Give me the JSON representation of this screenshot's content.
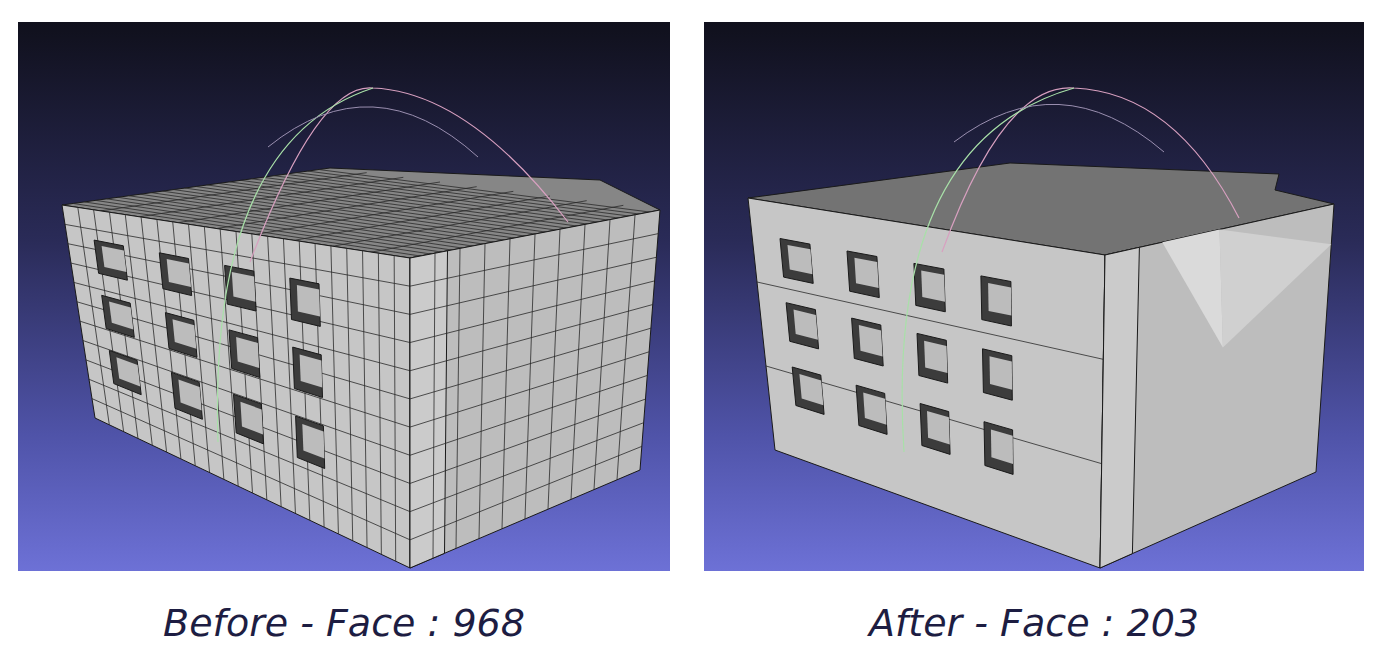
{
  "panels": [
    {
      "caption": "Before - Face : 968",
      "dense_mesh": true
    },
    {
      "caption": "After - Face : 203",
      "dense_mesh": false
    }
  ]
}
